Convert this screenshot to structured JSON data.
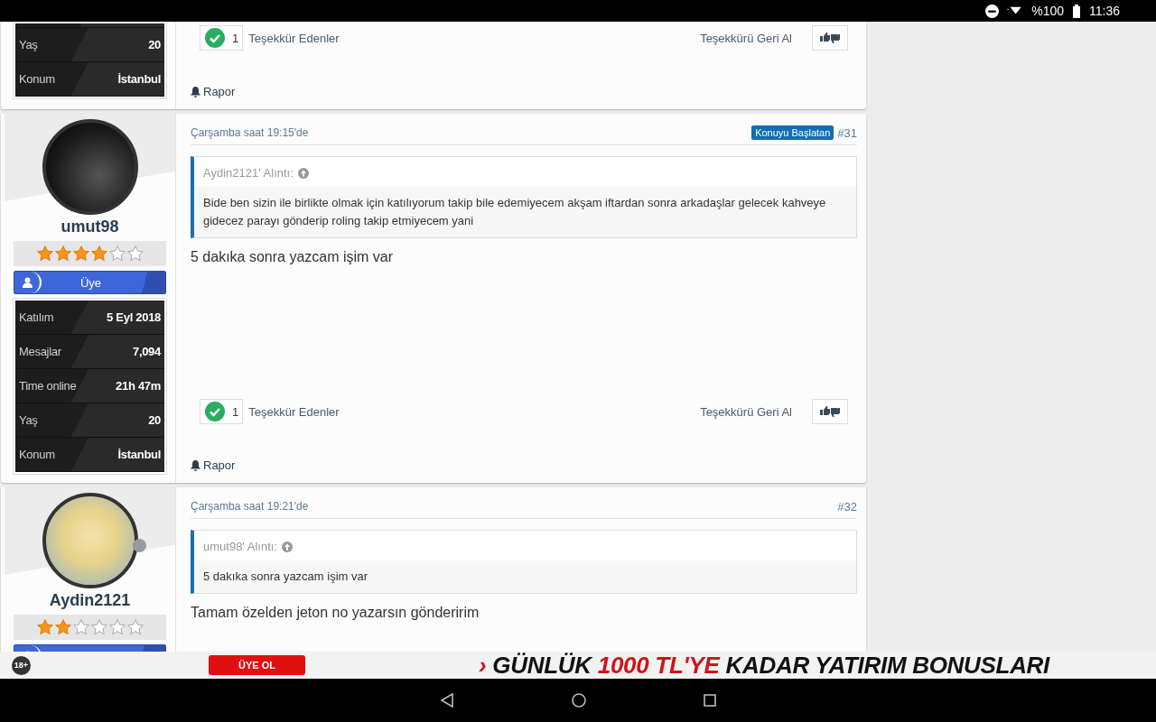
{
  "status_bar": {
    "battery": "%100",
    "time": "11:36"
  },
  "posts": [
    {
      "stats": [
        {
          "label": "Yaş",
          "value": "20"
        },
        {
          "label": "Konum",
          "value": "İstanbul"
        }
      ],
      "thanks": {
        "count": "1",
        "label": "Teşekkür Edenler",
        "undo": "Teşekkürü Geri Al"
      },
      "report": "Rapor"
    },
    {
      "username": "umut98",
      "stars": 4,
      "rank": "Üye",
      "stats": [
        {
          "label": "Katılım",
          "value": "5 Eyl 2018"
        },
        {
          "label": "Mesajlar",
          "value": "7,094"
        },
        {
          "label": "Time online",
          "value": "21h 47m"
        },
        {
          "label": "Yaş",
          "value": "20"
        },
        {
          "label": "Konum",
          "value": "İstanbul"
        }
      ],
      "date": "Çarşamba saat 19:15'de",
      "starter_badge": "Konuyu Başlatan",
      "number": "#31",
      "quote": {
        "header": "Aydin2121' Alıntı:",
        "text": "Bide ben sizin ile birlikte olmak için katılıyorum takip bile edemiyecem akşam iftardan sonra arkadaşlar gelecek kahveye gidecez parayı gönderip roling takip etmiyecem yani"
      },
      "message": "5 dakıka sonra yazcam işim var",
      "thanks": {
        "count": "1",
        "label": "Teşekkür Edenler",
        "undo": "Teşekkürü Geri Al"
      },
      "report": "Rapor"
    },
    {
      "username": "Aydin2121",
      "stars": 2,
      "online": false,
      "date": "Çarşamba saat 19:21'de",
      "number": "#32",
      "quote": {
        "header": "umut98' Alıntı:",
        "text": "5 dakıka sonra yazcam işim var"
      },
      "message": "Tamam özelden jeton no yazarsın gönderirim"
    }
  ],
  "ad_banner": {
    "age_badge": "18+",
    "button": "ÜYE OL",
    "headline": [
      {
        "text": "›",
        "highlight": true
      },
      {
        "text": "GÜNLÜK",
        "highlight": false
      },
      {
        "text": "1000 TL'YE",
        "highlight": true
      },
      {
        "text": "KADAR YATIRIM BONUSLARI",
        "highlight": false
      }
    ]
  }
}
